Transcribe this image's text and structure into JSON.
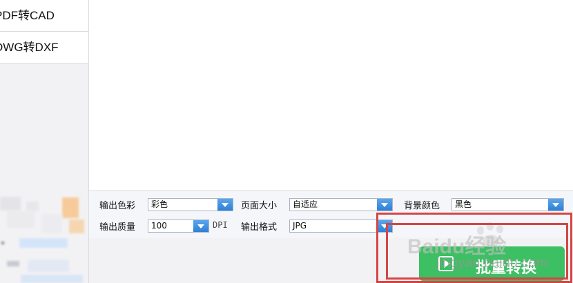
{
  "sidebar": {
    "items": [
      {
        "label": "PDF转CAD"
      },
      {
        "label": "DWG转DXF"
      }
    ]
  },
  "options": {
    "row1": {
      "color_label": "输出色彩",
      "color_value": "彩色",
      "page_size_label": "页面大小",
      "page_size_value": "自适应",
      "bg_color_label": "背景颜色",
      "bg_color_value": "黑色"
    },
    "row2": {
      "quality_label": "输出质量",
      "quality_value": "100",
      "quality_unit": "DPI",
      "format_label": "输出格式",
      "format_value": "JPG"
    }
  },
  "convert_button": {
    "label": "批量转换"
  },
  "watermark": {
    "logo_text": "Baidu经验",
    "url_text": "jingyan.baidu.com"
  },
  "colors": {
    "accent_green": "#3dbf63",
    "combo_arrow_blue": "#2f7fd6",
    "annotation_red": "#d64545"
  }
}
